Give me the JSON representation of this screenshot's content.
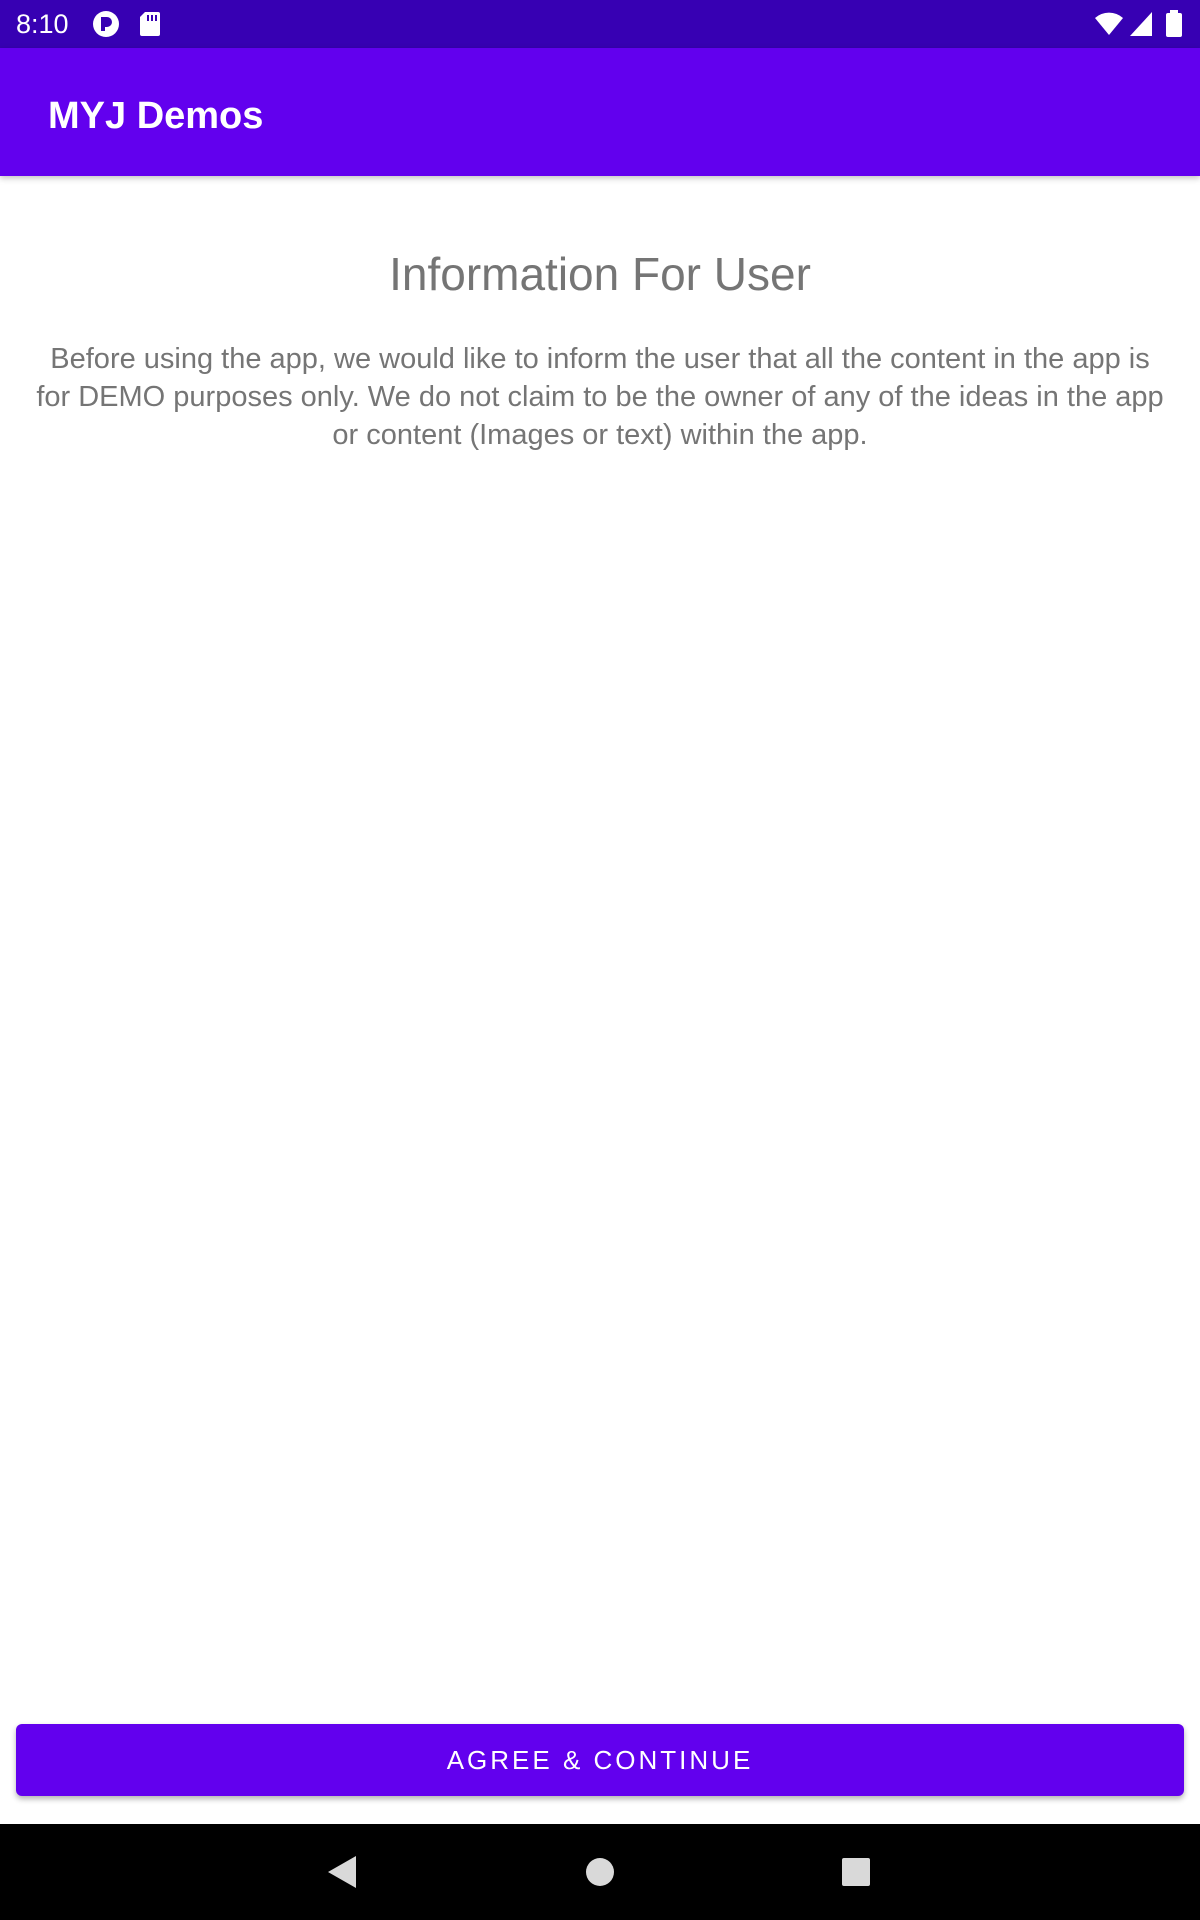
{
  "status_bar": {
    "time": "8:10",
    "icons_left": [
      "mobile-data-saver-icon",
      "sd-card-icon"
    ],
    "icons_right": [
      "wifi-icon",
      "signal-icon",
      "battery-icon"
    ],
    "background": "#3700b3"
  },
  "app_bar": {
    "title": "MYJ Demos",
    "background": "#6200ee"
  },
  "info": {
    "heading": "Information For User",
    "body": "Before using the app, we would like to inform the user that all the content in the app is for DEMO purposes only. We do not claim to be the owner of any of the ideas in the app or content (Images or text) within the app."
  },
  "actions": {
    "agree_label": "AGREE & CONTINUE",
    "accent": "#6200ee"
  },
  "nav_bar": {
    "icons": [
      "back-icon",
      "home-icon",
      "recents-icon"
    ]
  }
}
